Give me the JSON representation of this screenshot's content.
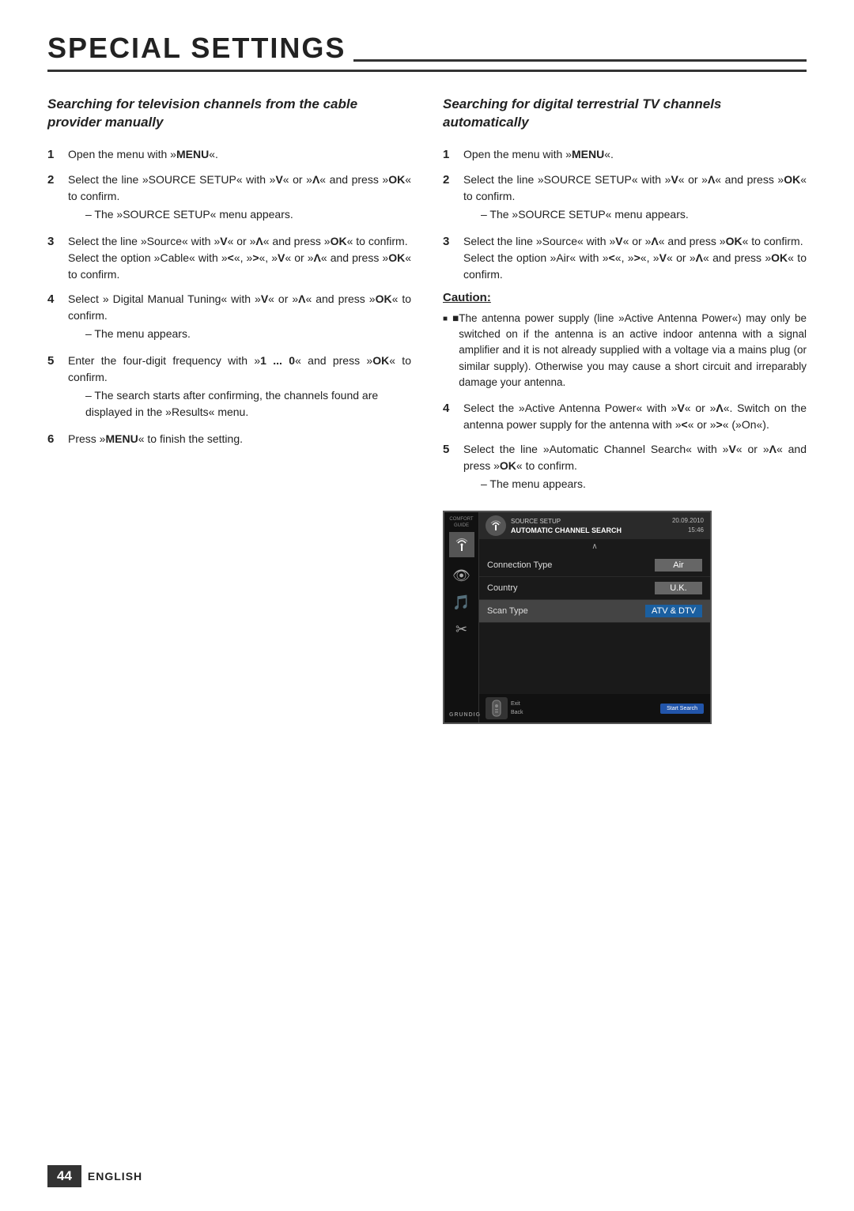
{
  "page": {
    "title": "SPECIAL SETTINGS",
    "footer": {
      "page_number": "44",
      "language": "ENGLISH"
    }
  },
  "col_left": {
    "heading": "Searching for television channels from the cable provider manually",
    "steps": [
      {
        "num": "1",
        "text": "Open the menu with »MENU«."
      },
      {
        "num": "2",
        "text": "Select the line »SOURCE SETUP« with »V« or »Λ« and press »OK« to confirm.",
        "sub": "– The »SOURCE SETUP« menu appears."
      },
      {
        "num": "3",
        "text": "Select the line »Source« with »V« or »Λ« and press »OK« to confirm. Select the option »Cable« with »<«, »>«, »V« or »Λ« and press »OK« to confirm."
      },
      {
        "num": "4",
        "text": "Select » Digital Manual Tuning« with »V« or »Λ« and press »OK« to confirm.",
        "sub": "– The menu appears."
      },
      {
        "num": "5",
        "text": "Enter the four-digit frequency with »1 ... 0« and press »OK« to confirm.",
        "sub": "– The search starts after confirming, the channels found are displayed in the »Results« menu."
      },
      {
        "num": "6",
        "text": "Press »MENU« to finish the setting."
      }
    ]
  },
  "col_right": {
    "heading": "Searching for digital terrestrial TV channels automatically",
    "steps": [
      {
        "num": "1",
        "text": "Open the menu with »MENU«."
      },
      {
        "num": "2",
        "text": "Select the line »SOURCE SETUP« with »V« or »Λ« and press »OK« to confirm.",
        "sub": "– The »SOURCE SETUP« menu appears."
      },
      {
        "num": "3",
        "text": "Select the line »Source« with »V« or »Λ« and press »OK« to confirm. Select the option »Air« with »<«, »>«, »V« or »Λ« and press »OK« to confirm."
      },
      {
        "num": "4",
        "text": "Select the »Active Antenna Power« with »V« or »Λ«. Switch on the antenna power supply for the antenna with »<« or »>« (»On«)."
      },
      {
        "num": "5",
        "text": "Select the line »Automatic Channel Search« with »V« or »Λ« and press »OK« to confirm.",
        "sub": "– The menu appears."
      }
    ],
    "caution": {
      "heading": "Caution:",
      "items": [
        "The antenna power supply (line »Active Antenna Power«) may only be switched on if the antenna is an active indoor antenna with a signal amplifier and it is not already supplied with a voltage via a mains plug (or similar supply). Otherwise you may cause a short circuit and irreparably damage your antenna."
      ]
    },
    "tv_screen": {
      "header": {
        "icon": "📡",
        "source_label": "SOURCE SETUP",
        "menu_title": "AUTOMATIC CHANNEL SEARCH",
        "date": "20.09.2010",
        "time": "15:46"
      },
      "menu_rows": [
        {
          "label": "Connection Type",
          "value": "Air",
          "highlighted": false
        },
        {
          "label": "Country",
          "value": "U.K.",
          "highlighted": false
        },
        {
          "label": "Scan Type",
          "value": "ATV & DTV",
          "highlighted": true
        }
      ],
      "footer": {
        "exit_label": "Exit",
        "back_label": "Back",
        "action_label": "Start Search"
      },
      "sidebar_icons": [
        {
          "icon": "📡",
          "active": true
        },
        {
          "icon": "👁",
          "active": false
        },
        {
          "icon": "🎵",
          "active": false
        },
        {
          "icon": "✂",
          "active": false
        }
      ],
      "grundig": "GRUNDIG"
    }
  }
}
